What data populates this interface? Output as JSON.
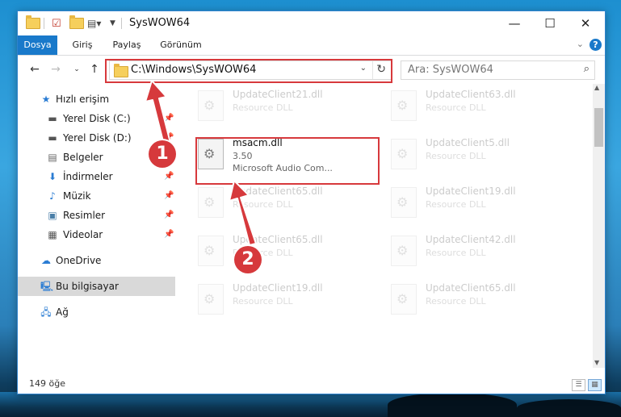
{
  "window": {
    "title": "SysWOW64",
    "controls": {
      "minimize": "—",
      "maximize": "☐",
      "close": "✕"
    }
  },
  "ribbon": {
    "tabs": [
      "Dosya",
      "Giriş",
      "Paylaş",
      "Görünüm"
    ],
    "help": "?"
  },
  "nav": {
    "address": "C:\\Windows\\SysWOW64",
    "search_placeholder": "Ara: SysWOW64"
  },
  "sidebar": {
    "items": [
      {
        "label": "Hızlı erişim",
        "icon": "star-icon",
        "pinned": false
      },
      {
        "label": "Yerel Disk (C:)",
        "icon": "drive-icon",
        "pinned": true
      },
      {
        "label": "Yerel Disk (D:)",
        "icon": "drive-icon",
        "pinned": true
      },
      {
        "label": "Belgeler",
        "icon": "documents-icon",
        "pinned": true
      },
      {
        "label": "İndirmeler",
        "icon": "download-icon",
        "pinned": true
      },
      {
        "label": "Müzik",
        "icon": "music-icon",
        "pinned": true
      },
      {
        "label": "Resimler",
        "icon": "pictures-icon",
        "pinned": true
      },
      {
        "label": "Videolar",
        "icon": "video-icon",
        "pinned": true
      },
      {
        "label": "OneDrive",
        "icon": "cloud-icon",
        "pinned": false
      },
      {
        "label": "Bu bilgisayar",
        "icon": "computer-icon",
        "pinned": false,
        "selected": true
      },
      {
        "label": "Ağ",
        "icon": "network-icon",
        "pinned": false
      }
    ]
  },
  "files": {
    "left_column": [
      {
        "name": "UpdateClient21.dll",
        "type": "Resource DLL"
      },
      {
        "name": "msacm.dll",
        "version": "3.50",
        "description": "Microsoft Audio Com...",
        "highlighted": true
      },
      {
        "name": "UpdateClient65.dll",
        "type": "Resource DLL"
      },
      {
        "name": "UpdateClient65.dll",
        "type": "Resource DLL"
      },
      {
        "name": "UpdateClient19.dll",
        "type": "Resource DLL"
      }
    ],
    "right_column": [
      {
        "name": "UpdateClient63.dll",
        "type": "Resource DLL"
      },
      {
        "name": "UpdateClient5.dll",
        "type": "Resource DLL"
      },
      {
        "name": "UpdateClient19.dll",
        "type": "Resource DLL"
      },
      {
        "name": "UpdateClient42.dll",
        "type": "Resource DLL"
      },
      {
        "name": "UpdateClient65.dll",
        "type": "Resource DLL"
      }
    ]
  },
  "status": {
    "count": "149 öğe"
  },
  "annotations": {
    "step1": "1",
    "step2": "2",
    "color": "#d6393c"
  }
}
